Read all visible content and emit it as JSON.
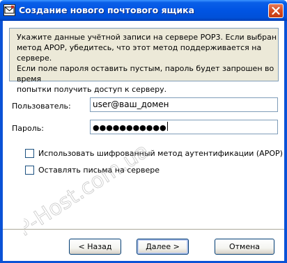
{
  "window": {
    "title": "Создание нового почтового ящика",
    "close_glyph": "✕"
  },
  "info": {
    "lines": [
      "Укажите данные учётной записи на сервере POP3. Если выбран",
      "метод APOP, убедитесь, что этот метод поддерживается на сервере.",
      "Если поле пароля оставить пустым, пароль будет запрошен во время",
      "попытки получить доступ к серверу."
    ]
  },
  "form": {
    "user_label": "Пользователь:",
    "user_value": "user@ваш_домен",
    "password_label": "Пароль:",
    "password_masked": "●●●●●●●●●●●"
  },
  "options": {
    "apop_label": "Использовать шифрованный метод аутентификации (APOP)",
    "apop_checked": false,
    "keep_label": "Оставлять письма на сервере",
    "keep_checked": false
  },
  "buttons": {
    "back": "< Назад",
    "next": "Далее >",
    "cancel": "Отмена"
  },
  "watermark": {
    "text": "P-Host.com.ua",
    "color": "#9a9a9a"
  },
  "colors": {
    "titlebar": "#0054e3",
    "panel": "#ece9d8",
    "input_border": "#7f9db9",
    "button_border": "#003c74"
  },
  "icons": {
    "app": "mail-account-icon",
    "close": "close-icon"
  }
}
